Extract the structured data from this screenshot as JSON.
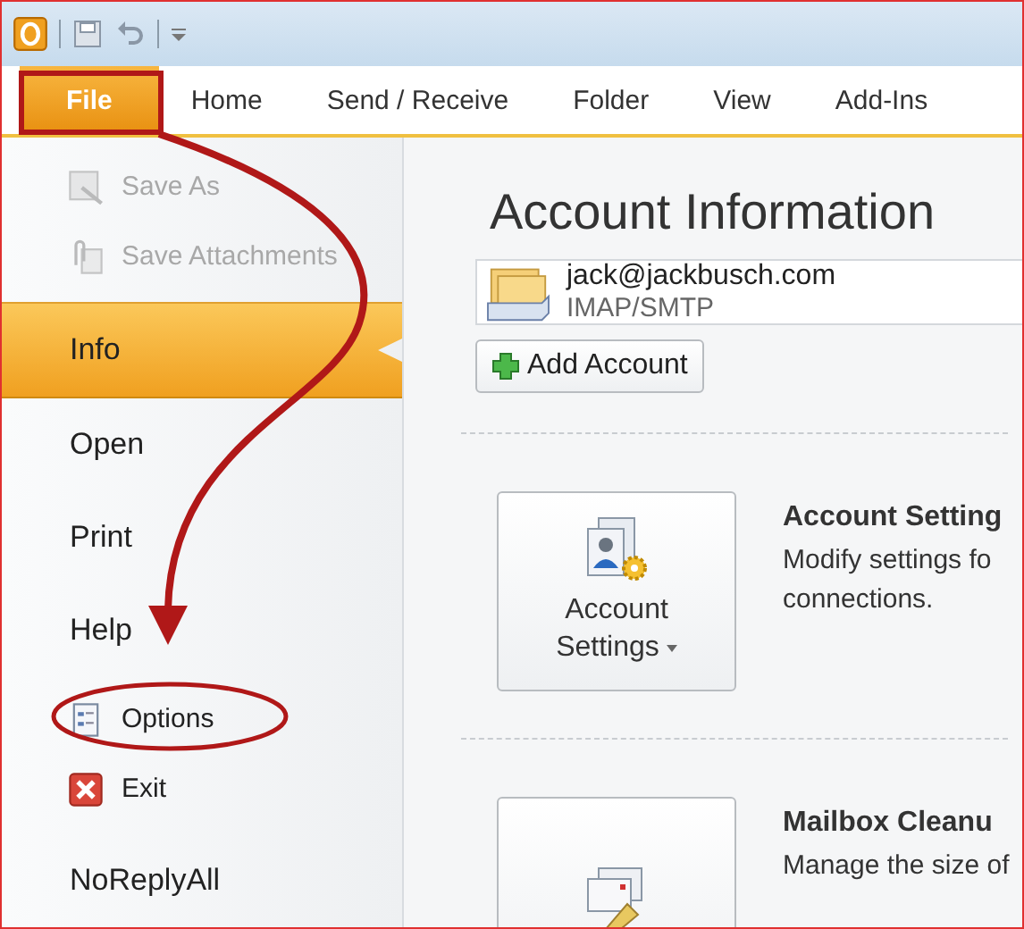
{
  "ribbon_tabs": [
    {
      "label": "File",
      "selected": true
    },
    {
      "label": "Home",
      "selected": false
    },
    {
      "label": "Send / Receive",
      "selected": false
    },
    {
      "label": "Folder",
      "selected": false
    },
    {
      "label": "View",
      "selected": false
    },
    {
      "label": "Add-Ins",
      "selected": false
    }
  ],
  "backstage_menu": [
    {
      "label": "Save As",
      "kind": "command",
      "disabled": true,
      "selected": false
    },
    {
      "label": "Save Attachments",
      "kind": "command",
      "disabled": true,
      "selected": false
    },
    {
      "label": "Info",
      "kind": "page",
      "disabled": false,
      "selected": true
    },
    {
      "label": "Open",
      "kind": "page",
      "disabled": false,
      "selected": false
    },
    {
      "label": "Print",
      "kind": "page",
      "disabled": false,
      "selected": false
    },
    {
      "label": "Help",
      "kind": "page",
      "disabled": false,
      "selected": false
    },
    {
      "label": "Options",
      "kind": "command",
      "disabled": false,
      "selected": false
    },
    {
      "label": "Exit",
      "kind": "command",
      "disabled": false,
      "selected": false
    },
    {
      "label": "NoReplyAll",
      "kind": "page",
      "disabled": false,
      "selected": false
    }
  ],
  "content": {
    "title": "Account Information",
    "account": {
      "email": "jack@jackbusch.com",
      "type": "IMAP/SMTP"
    },
    "add_account_button": "Add Account",
    "sections": [
      {
        "button_label": "Account Settings",
        "dropdown": true,
        "heading": "Account Setting",
        "description_lines": [
          "Modify settings fo",
          "connections."
        ]
      },
      {
        "heading": "Mailbox Cleanu",
        "description_lines": [
          "Manage the size of"
        ]
      }
    ]
  }
}
